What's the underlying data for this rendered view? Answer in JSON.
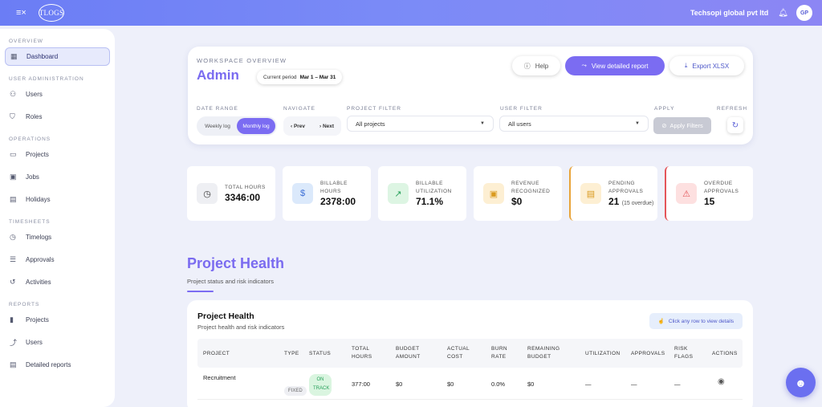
{
  "topbar": {
    "company": "Techsopi global pvt ltd",
    "avatar": "GP",
    "logo": "TLOGS",
    "menu_icon": "menu-icon",
    "bell_icon": "bell-icon"
  },
  "sidebar": {
    "sections": [
      {
        "title": "OVERVIEW",
        "items": [
          {
            "label": "Dashboard",
            "icon": "grid-icon",
            "active": true
          }
        ]
      },
      {
        "title": "USER ADMINISTRATION",
        "items": [
          {
            "label": "Users",
            "icon": "users-icon"
          },
          {
            "label": "Roles",
            "icon": "shield-icon"
          }
        ]
      },
      {
        "title": "OPERATIONS",
        "items": [
          {
            "label": "Projects",
            "icon": "folder-icon"
          },
          {
            "label": "Jobs",
            "icon": "briefcase-icon"
          },
          {
            "label": "Holidays",
            "icon": "calendar-icon"
          }
        ]
      },
      {
        "title": "TIMESHEETS",
        "items": [
          {
            "label": "Timelogs",
            "icon": "clock-icon"
          },
          {
            "label": "Approvals",
            "icon": "checklist-icon"
          },
          {
            "label": "Activities",
            "icon": "history-icon"
          }
        ]
      },
      {
        "title": "REPORTS",
        "items": [
          {
            "label": "Projects",
            "icon": "bar-chart-icon"
          },
          {
            "label": "Users",
            "icon": "trend-icon"
          },
          {
            "label": "Detailed reports",
            "icon": "report-icon"
          }
        ]
      }
    ]
  },
  "workspace": {
    "eyebrow": "WORKSPACE OVERVIEW",
    "title": "Admin",
    "period_label": "Current period",
    "period_value": "Mar 1 – Mar 31",
    "help": "Help",
    "view_report": "View detailed report",
    "export": "Export XLSX",
    "filters": {
      "date_range_label": "DATE RANGE",
      "weekly": "Weekly log",
      "monthly": "Monthly log",
      "navigate_label": "NAVIGATE",
      "prev": "Prev",
      "next": "Next",
      "project_filter_label": "PROJECT FILTER",
      "project_value": "All projects",
      "user_filter_label": "USER FILTER",
      "user_value": "All users",
      "apply_label": "APPLY",
      "apply_button": "Apply Filters",
      "refresh_label": "REFRESH"
    }
  },
  "stats": [
    {
      "label": "TOTAL HOURS",
      "value": "3346:00",
      "icon": "clock-icon",
      "color": "#eeeff3"
    },
    {
      "label": "BILLABLE HOURS",
      "value": "2378:00",
      "icon": "dollar-icon",
      "color": "#dbe9fb"
    },
    {
      "label": "BILLABLE UTILIZATION",
      "value": "71.1%",
      "icon": "trend-up-icon",
      "color": "#ddf5e3"
    },
    {
      "label": "REVENUE RECOGNIZED",
      "value": "$0",
      "icon": "wallet-icon",
      "color": "#fdefd3"
    },
    {
      "label": "PENDING APPROVALS",
      "value": "21",
      "sub": "(15 overdue)",
      "icon": "clipboard-clock-icon",
      "color": "#fdefd3",
      "accent": "#e9a43a"
    },
    {
      "label": "OVERDUE APPROVALS",
      "value": "15",
      "icon": "warning-icon",
      "color": "#fde0e0",
      "accent": "#e4555a"
    }
  ],
  "project_health": {
    "heading": "Project Health",
    "subheading": "Project status and risk indicators",
    "card_title": "Project Health",
    "card_subtitle": "Project health and risk indicators",
    "row_hint": "Click any row to view details",
    "columns": [
      "PROJECT",
      "TYPE",
      "STATUS",
      "TOTAL HOURS",
      "BUDGET AMOUNT",
      "ACTUAL COST",
      "BURN RATE",
      "REMAINING BUDGET",
      "UTILIZATION",
      "APPROVALS",
      "RISK FLAGS",
      "ACTIONS"
    ],
    "rows": [
      {
        "project": "Recruitment",
        "type": "FIXED",
        "status": "ON TRACK",
        "total_hours": "377:00",
        "budget": "$0",
        "actual": "$0",
        "burn": "0.0%",
        "remaining": "$0",
        "utilization": "—",
        "approvals": "—",
        "risk": "—"
      }
    ]
  }
}
